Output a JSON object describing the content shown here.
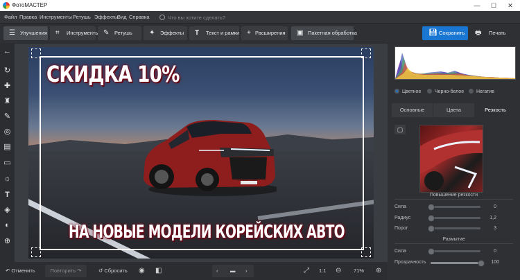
{
  "window": {
    "title": "ФотоМАСТЕР",
    "minimize": "—",
    "maximize": "☐",
    "close": "✕"
  },
  "menu": {
    "items": [
      "Файл",
      "Правка",
      "Инструменты",
      "Ретушь",
      "Эффекты",
      "Вид",
      "Справка"
    ],
    "search_placeholder": "Что вы хотите сделать?"
  },
  "tabs": [
    {
      "label": "Улучшения",
      "icon": "sliders-icon",
      "active": true
    },
    {
      "label": "Инструменты",
      "icon": "crop-icon",
      "active": false
    },
    {
      "label": "Ретушь",
      "icon": "brush-icon",
      "active": false
    },
    {
      "label": "Эффекты",
      "icon": "magic-wand-icon",
      "active": false
    },
    {
      "label": "Текст и рамки",
      "icon": "text-icon",
      "active": false
    },
    {
      "label": "Расширения",
      "icon": "plus-icon",
      "active": false
    },
    {
      "label": "Пакетная обработка",
      "icon": "batch-icon",
      "active": false
    }
  ],
  "actions": {
    "save": "Сохранить",
    "print": "Печать"
  },
  "canvas": {
    "promo_top": "СКИДКА 10%",
    "promo_bottom": "НА НОВЫЕ МОДЕЛИ КОРЕЙСКИХ АВТО",
    "plate": "TUCSON TF-LINE"
  },
  "bottom": {
    "undo": "Отменить",
    "redo": "Повторить",
    "reset": "Сбросить",
    "zoom_one": "1:1",
    "zoom_value": "71%"
  },
  "panel": {
    "color_modes": [
      "Цветное",
      "Черно-белое",
      "Негатив"
    ],
    "selected_mode": "Цветное",
    "tabs": [
      "Основные",
      "Цвета",
      "Резкость"
    ],
    "active_tab": "Резкость",
    "sharpen_section": "Повышение резкости",
    "blur_section": "Размытие",
    "sliders": [
      {
        "label": "Сила",
        "value": "0",
        "fraction": 0.0
      },
      {
        "label": "Радиус",
        "value": "1,2",
        "fraction": 0.0
      },
      {
        "label": "Порог",
        "value": "3",
        "fraction": 0.0
      },
      {
        "label": "Сила",
        "value": "0",
        "fraction": 0.0
      },
      {
        "label": "Прозрачность",
        "value": "100",
        "fraction": 1.0
      }
    ]
  },
  "colors": {
    "accent": "#1976d2",
    "bg": "#2b2d30",
    "promo_glow": "#7a1020"
  }
}
